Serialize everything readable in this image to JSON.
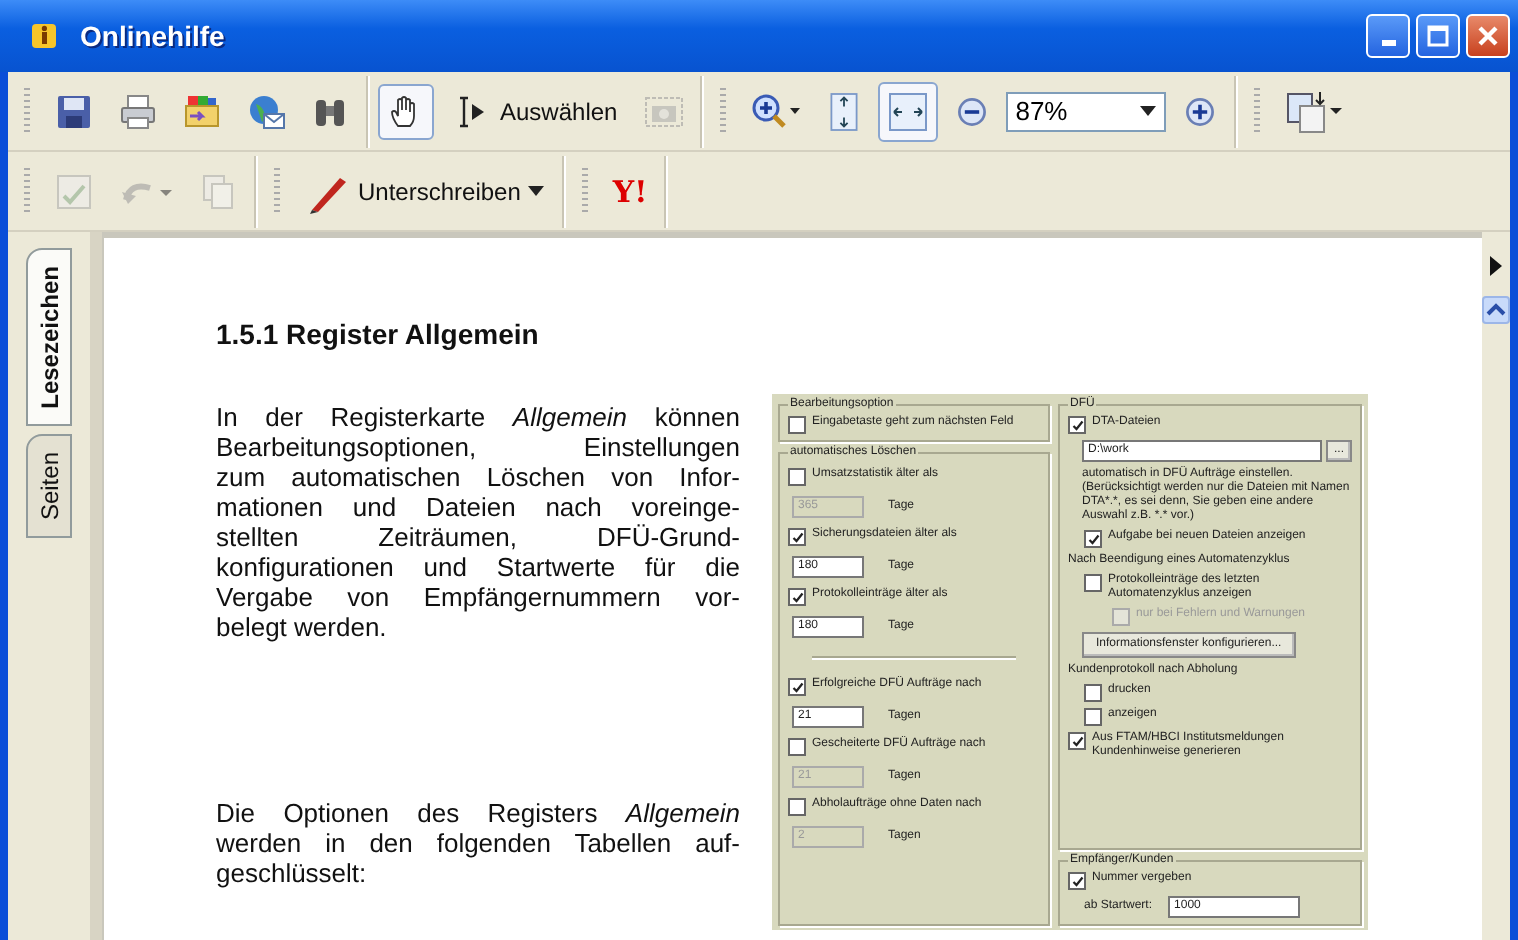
{
  "window": {
    "title": "Onlinehilfe"
  },
  "toolbar": {
    "spellcheck": {
      "disabled": true
    },
    "undo": {
      "disabled": true
    },
    "copy": {
      "disabled": true
    },
    "snapshot": {
      "disabled": true
    },
    "hand_tool": {
      "selected": true
    },
    "select_tool": {
      "label": "Auswählen"
    },
    "fit_page": {
      "selected": false
    },
    "fit_width": {
      "selected": true
    },
    "zoom": {
      "value": "87%"
    },
    "sign": {
      "label": "Unterschreiben"
    },
    "yahoo": {
      "label": "Y!"
    }
  },
  "side_tabs": [
    {
      "label": "Lesezeichen",
      "selected": true
    },
    {
      "label": "Seiten",
      "selected": false
    }
  ],
  "document": {
    "heading": "1.5.1  Register Allgemein",
    "paragraphs": [
      {
        "lines": [
          "In der Registerkarte *Allgemein* können",
          "Bearbeitungsoptionen, Einstellungen",
          "zum automatischen Löschen von Infor-",
          "mationen und Dateien nach voreinge-",
          "stellten Zeiträumen, DFÜ-Grund-",
          "konfigurationen und Startwerte für die",
          "Vergabe von Empfängernummern vor-",
          "belegt werden."
        ]
      },
      {
        "lines": [
          "Die Optionen des Registers *Allgemein*",
          "werden in den folgenden Tabellen auf-",
          "geschlüsselt:"
        ]
      }
    ],
    "dialog": {
      "left": [
        {
          "title": "Bearbeitungsoption",
          "rows": [
            {
              "kind": "check",
              "label": "Eingabetaste geht zum nächsten Feld",
              "checked": false
            }
          ]
        },
        {
          "title": "automatisches Löschen",
          "rows": [
            {
              "kind": "check",
              "label": "Umsatzstatistik älter als",
              "checked": false
            },
            {
              "kind": "field",
              "value": "365",
              "unit": "Tage",
              "disabled": true
            },
            {
              "kind": "check",
              "label": "Sicherungsdateien älter als",
              "checked": true
            },
            {
              "kind": "field",
              "value": "180",
              "unit": "Tage",
              "disabled": false
            },
            {
              "kind": "check",
              "label": "Protokolleinträge älter als",
              "checked": true
            },
            {
              "kind": "field",
              "value": "180",
              "unit": "Tage",
              "disabled": false
            },
            {
              "kind": "separator"
            },
            {
              "kind": "check",
              "label": "Erfolgreiche DFÜ Aufträge nach",
              "checked": true
            },
            {
              "kind": "field",
              "value": "21",
              "unit": "Tagen",
              "disabled": false
            },
            {
              "kind": "check",
              "label": "Gescheiterte DFÜ Aufträge nach",
              "checked": false
            },
            {
              "kind": "field",
              "value": "21",
              "unit": "Tagen",
              "disabled": true
            },
            {
              "kind": "check",
              "label": "Abholaufträge ohne Daten nach",
              "checked": false
            },
            {
              "kind": "field",
              "value": "2",
              "unit": "Tagen",
              "disabled": true
            }
          ]
        }
      ],
      "right": [
        {
          "title": "DFÜ",
          "rows": [
            {
              "kind": "check",
              "label": "DTA-Dateien",
              "checked": true
            },
            {
              "kind": "path",
              "value": "D:\\work",
              "button": "..."
            },
            {
              "kind": "note",
              "text": "automatisch in DFÜ Aufträge einstellen. (Berücksichtigt werden nur die Dateien mit Namen DTA*.*, es sei denn, Sie geben eine andere Auswahl z.B. *.* vor.)"
            },
            {
              "kind": "check",
              "label": "Aufgabe bei neuen Dateien anzeigen",
              "checked": true,
              "indented": true
            },
            {
              "kind": "label",
              "text": "Nach Beendigung eines Automatenzyklus"
            },
            {
              "kind": "check",
              "label": "Protokolleinträge des letzten Automatenzyklus anzeigen",
              "checked": false,
              "indented": true
            },
            {
              "kind": "check",
              "label": "nur bei Fehlern und Warnungen",
              "checked": false,
              "disabled": true,
              "indented": true,
              "deep": true
            },
            {
              "kind": "button",
              "label": "Informationsfenster konfigurieren..."
            },
            {
              "kind": "label",
              "text": "Kundenprotokoll nach Abholung"
            },
            {
              "kind": "check",
              "label": "drucken",
              "checked": false,
              "indented": true
            },
            {
              "kind": "check",
              "label": "anzeigen",
              "checked": false,
              "indented": true
            },
            {
              "kind": "check",
              "label": "Aus FTAM/HBCI Institutsmeldungen Kundenhinweise generieren",
              "checked": true
            }
          ]
        },
        {
          "title": "Empfänger/Kunden",
          "rows": [
            {
              "kind": "check",
              "label": "Nummer vergeben",
              "checked": true
            },
            {
              "kind": "start",
              "label": "ab Startwert:",
              "value": "1000"
            }
          ]
        }
      ]
    }
  }
}
